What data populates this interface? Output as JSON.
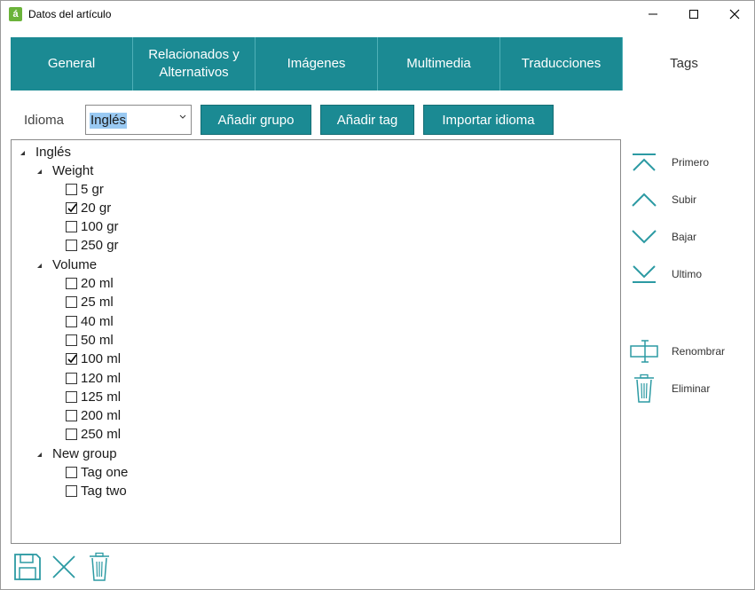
{
  "window": {
    "title": "Datos del artículo",
    "app_icon_glyph": "á"
  },
  "tabs": [
    {
      "label": "General",
      "active": false
    },
    {
      "label": "Relacionados y\nAlternativos",
      "active": false
    },
    {
      "label": "Imágenes",
      "active": false
    },
    {
      "label": "Multimedia",
      "active": false
    },
    {
      "label": "Traducciones",
      "active": false
    },
    {
      "label": "Tags",
      "active": true
    }
  ],
  "toolbar": {
    "language_label": "Idioma",
    "language_value": "Inglés",
    "add_group_label": "Añadir grupo",
    "add_tag_label": "Añadir tag",
    "import_language_label": "Importar idioma"
  },
  "tree": {
    "root": "Inglés",
    "groups": [
      {
        "name": "Weight",
        "tags": [
          {
            "label": "5 gr",
            "checked": false
          },
          {
            "label": "20 gr",
            "checked": true
          },
          {
            "label": "100 gr",
            "checked": false
          },
          {
            "label": "250 gr",
            "checked": false
          }
        ]
      },
      {
        "name": "Volume",
        "tags": [
          {
            "label": "20 ml",
            "checked": false
          },
          {
            "label": "25 ml",
            "checked": false
          },
          {
            "label": "40 ml",
            "checked": false
          },
          {
            "label": "50 ml",
            "checked": false
          },
          {
            "label": "100 ml",
            "checked": true
          },
          {
            "label": "120 ml",
            "checked": false
          },
          {
            "label": "125 ml",
            "checked": false
          },
          {
            "label": "200 ml",
            "checked": false
          },
          {
            "label": "250 ml",
            "checked": false
          }
        ]
      },
      {
        "name": "New group",
        "tags": [
          {
            "label": "Tag one",
            "checked": false
          },
          {
            "label": "Tag two",
            "checked": false
          }
        ]
      }
    ]
  },
  "side_actions": {
    "first": "Primero",
    "up": "Subir",
    "down": "Bajar",
    "last": "Ultimo",
    "rename": "Renombrar",
    "delete": "Eliminar"
  },
  "icons": {
    "save": "save-icon",
    "cancel": "close-icon",
    "delete": "trash-icon"
  },
  "colors": {
    "accent": "#1b8a93",
    "icon_teal": "#2c9aa3",
    "selection": "#99c9f2"
  }
}
